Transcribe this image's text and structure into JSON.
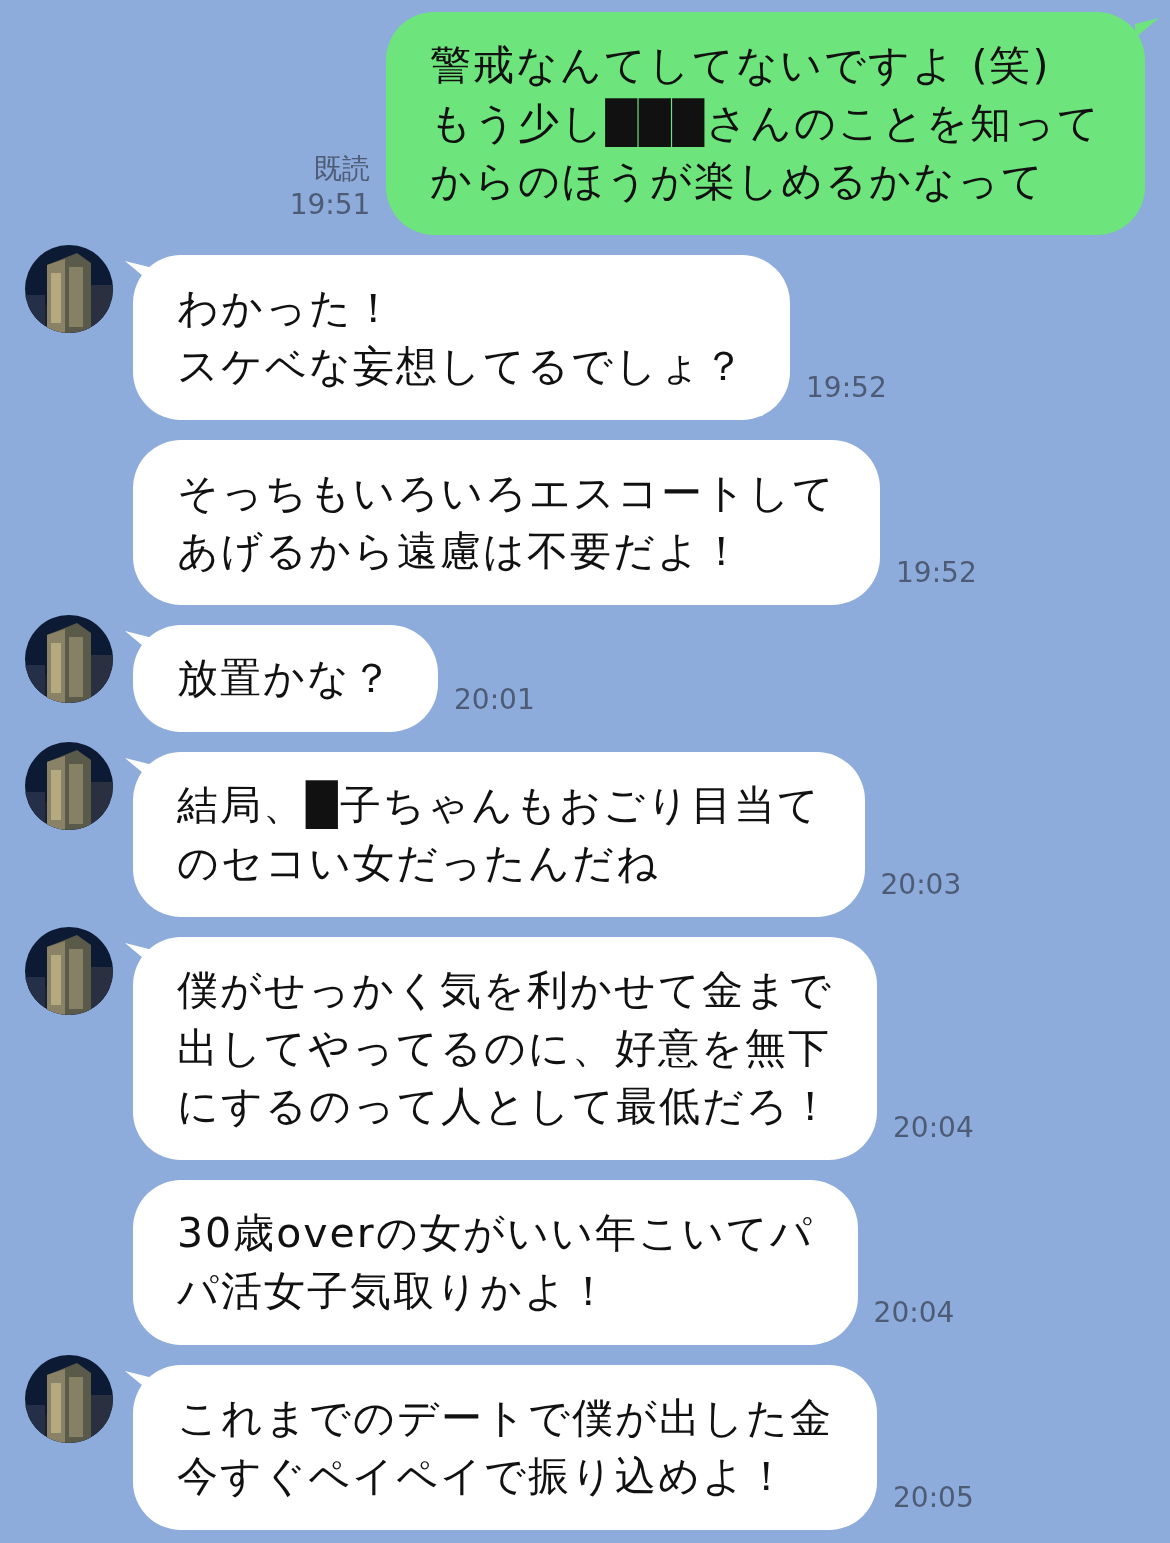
{
  "messages": [
    {
      "kind": "out",
      "read": "既読",
      "time": "19:51",
      "show_avatar": false,
      "lines": [
        "警戒なんてしてないですよ (笑)",
        "もう少し███さんのことを知って",
        "からのほうが楽しめるかなって"
      ]
    },
    {
      "kind": "in",
      "time": "19:52",
      "show_avatar": true,
      "lines": [
        "わかった！",
        "スケベな妄想してるでしょ？"
      ]
    },
    {
      "kind": "in",
      "time": "19:52",
      "show_avatar": false,
      "lines": [
        "そっちもいろいろエスコートして",
        "あげるから遠慮は不要だよ！"
      ]
    },
    {
      "kind": "in",
      "time": "20:01",
      "show_avatar": true,
      "lines": [
        "放置かな？"
      ]
    },
    {
      "kind": "in",
      "time": "20:03",
      "show_avatar": true,
      "lines": [
        "結局、█子ちゃんもおごり目当て",
        "のセコい女だったんだね"
      ]
    },
    {
      "kind": "in",
      "time": "20:04",
      "show_avatar": true,
      "lines": [
        "僕がせっかく気を利かせて金まで",
        "出してやってるのに、好意を無下",
        "にするのって人として最低だろ！"
      ]
    },
    {
      "kind": "in",
      "time": "20:04",
      "show_avatar": false,
      "lines": [
        "30歳overの女がいい年こいてパ",
        "パ活女子気取りかよ！"
      ]
    },
    {
      "kind": "in",
      "time": "20:05",
      "show_avatar": true,
      "lines": [
        "これまでのデートで僕が出した金",
        "今すぐペイペイで振り込めよ！"
      ]
    }
  ]
}
